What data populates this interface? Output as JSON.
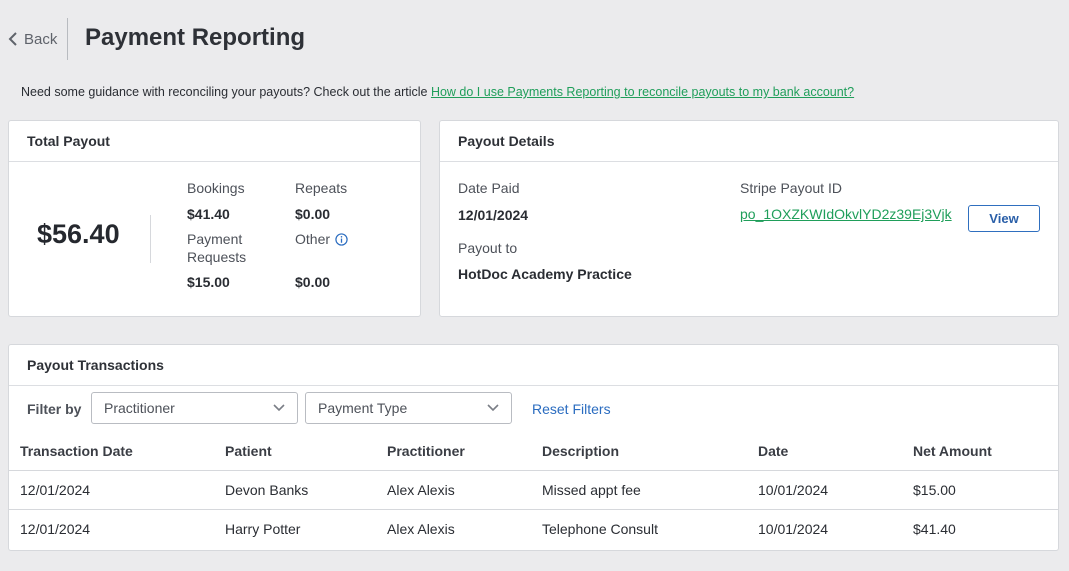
{
  "header": {
    "back_label": "Back",
    "title": "Payment Reporting"
  },
  "guidance": {
    "text": "Need some guidance with reconciling your payouts? Check out the article ",
    "link_text": "How do I use Payments Reporting to reconcile payouts to my bank account?"
  },
  "total_payout": {
    "title": "Total Payout",
    "amount": "$56.40",
    "bookings_label": "Bookings",
    "bookings_value": "$41.40",
    "repeats_label": "Repeats",
    "repeats_value": "$0.00",
    "payment_requests_label_1": "Payment",
    "payment_requests_label_2": "Requests",
    "payment_requests_value": "$15.00",
    "other_label": "Other",
    "other_value": "$0.00"
  },
  "payout_details": {
    "title": "Payout Details",
    "date_paid_label": "Date Paid",
    "date_paid_value": "12/01/2024",
    "payout_to_label": "Payout to",
    "payout_to_value": "HotDoc Academy Practice",
    "stripe_label": "Stripe Payout ID",
    "stripe_id": "po_1OXZKWIdOkvlYD2z39Ej3Vjk",
    "view_label": "View"
  },
  "transactions": {
    "title": "Payout Transactions",
    "filter_label": "Filter by",
    "practitioner_select": "Practitioner",
    "payment_type_select": "Payment Type",
    "reset_label": "Reset Filters",
    "columns": [
      "Transaction Date",
      "Patient",
      "Practitioner",
      "Description",
      "Date",
      "Net Amount"
    ],
    "rows": [
      [
        "12/01/2024",
        "Devon Banks",
        "Alex Alexis",
        "Missed appt fee",
        "10/01/2024",
        "$15.00"
      ],
      [
        "12/01/2024",
        "Harry Potter",
        "Alex Alexis",
        "Telephone Consult",
        "10/01/2024",
        "$41.40"
      ]
    ]
  },
  "colors": {
    "link_green": "#1f9e5a",
    "link_blue": "#2a6cc0",
    "info_blue": "#2a6cc0"
  }
}
